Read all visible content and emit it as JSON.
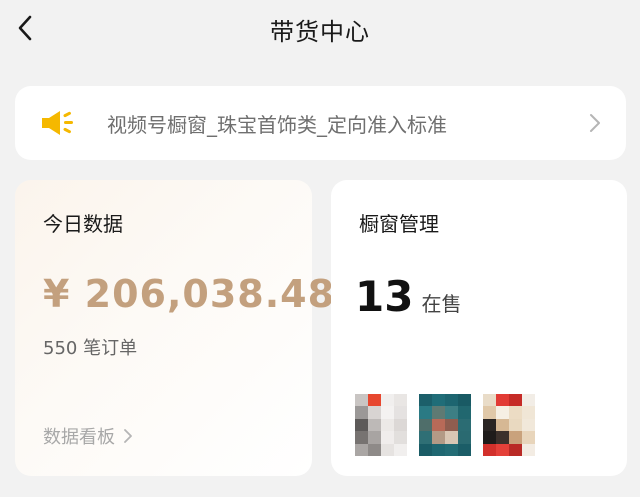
{
  "header": {
    "title": "带货中心",
    "back_icon": "chevron-left-icon"
  },
  "notice": {
    "icon": "speaker-icon",
    "icon_color": "#f5b800",
    "text": "视频号橱窗_珠宝首饰类_定向准入标准",
    "arrow_icon": "chevron-right-icon"
  },
  "today": {
    "title": "今日数据",
    "amount": "¥ 206,038.48",
    "amount_color": "#c3a07e",
    "orders": "550 笔订单",
    "dashboard_link": "数据看板"
  },
  "window": {
    "title": "橱窗管理",
    "count": "13",
    "count_unit": "在售",
    "thumbnails": [
      "product-thumbnail-1",
      "product-thumbnail-2",
      "product-thumbnail-3"
    ]
  }
}
